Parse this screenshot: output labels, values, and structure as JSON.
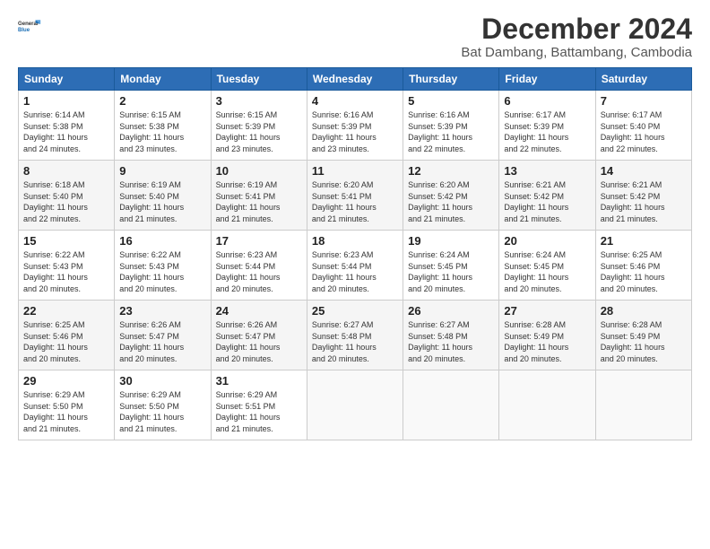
{
  "header": {
    "logo_line1": "General",
    "logo_line2": "Blue",
    "month_title": "December 2024",
    "subtitle": "Bat Dambang, Battambang, Cambodia"
  },
  "calendar": {
    "days_of_week": [
      "Sunday",
      "Monday",
      "Tuesday",
      "Wednesday",
      "Thursday",
      "Friday",
      "Saturday"
    ],
    "weeks": [
      [
        null,
        null,
        null,
        null,
        null,
        null,
        null
      ]
    ],
    "cells": [
      {
        "day": null,
        "sunrise": null,
        "sunset": null,
        "daylight": null
      },
      {
        "day": null,
        "sunrise": null,
        "sunset": null,
        "daylight": null
      },
      {
        "day": null,
        "sunrise": null,
        "sunset": null,
        "daylight": null
      },
      {
        "day": null,
        "sunrise": null,
        "sunset": null,
        "daylight": null
      },
      {
        "day": null,
        "sunrise": null,
        "sunset": null,
        "daylight": null
      },
      {
        "day": null,
        "sunrise": null,
        "sunset": null,
        "daylight": null
      },
      {
        "day": null,
        "sunrise": null,
        "sunset": null,
        "daylight": null
      }
    ]
  },
  "rows": [
    {
      "cells": [
        {
          "day": "1",
          "lines": [
            "Sunrise: 6:14 AM",
            "Sunset: 5:38 PM",
            "Daylight: 11 hours",
            "and 24 minutes."
          ]
        },
        {
          "day": "2",
          "lines": [
            "Sunrise: 6:15 AM",
            "Sunset: 5:38 PM",
            "Daylight: 11 hours",
            "and 23 minutes."
          ]
        },
        {
          "day": "3",
          "lines": [
            "Sunrise: 6:15 AM",
            "Sunset: 5:39 PM",
            "Daylight: 11 hours",
            "and 23 minutes."
          ]
        },
        {
          "day": "4",
          "lines": [
            "Sunrise: 6:16 AM",
            "Sunset: 5:39 PM",
            "Daylight: 11 hours",
            "and 23 minutes."
          ]
        },
        {
          "day": "5",
          "lines": [
            "Sunrise: 6:16 AM",
            "Sunset: 5:39 PM",
            "Daylight: 11 hours",
            "and 22 minutes."
          ]
        },
        {
          "day": "6",
          "lines": [
            "Sunrise: 6:17 AM",
            "Sunset: 5:39 PM",
            "Daylight: 11 hours",
            "and 22 minutes."
          ]
        },
        {
          "day": "7",
          "lines": [
            "Sunrise: 6:17 AM",
            "Sunset: 5:40 PM",
            "Daylight: 11 hours",
            "and 22 minutes."
          ]
        }
      ]
    },
    {
      "cells": [
        {
          "day": "8",
          "lines": [
            "Sunrise: 6:18 AM",
            "Sunset: 5:40 PM",
            "Daylight: 11 hours",
            "and 22 minutes."
          ]
        },
        {
          "day": "9",
          "lines": [
            "Sunrise: 6:19 AM",
            "Sunset: 5:40 PM",
            "Daylight: 11 hours",
            "and 21 minutes."
          ]
        },
        {
          "day": "10",
          "lines": [
            "Sunrise: 6:19 AM",
            "Sunset: 5:41 PM",
            "Daylight: 11 hours",
            "and 21 minutes."
          ]
        },
        {
          "day": "11",
          "lines": [
            "Sunrise: 6:20 AM",
            "Sunset: 5:41 PM",
            "Daylight: 11 hours",
            "and 21 minutes."
          ]
        },
        {
          "day": "12",
          "lines": [
            "Sunrise: 6:20 AM",
            "Sunset: 5:42 PM",
            "Daylight: 11 hours",
            "and 21 minutes."
          ]
        },
        {
          "day": "13",
          "lines": [
            "Sunrise: 6:21 AM",
            "Sunset: 5:42 PM",
            "Daylight: 11 hours",
            "and 21 minutes."
          ]
        },
        {
          "day": "14",
          "lines": [
            "Sunrise: 6:21 AM",
            "Sunset: 5:42 PM",
            "Daylight: 11 hours",
            "and 21 minutes."
          ]
        }
      ]
    },
    {
      "cells": [
        {
          "day": "15",
          "lines": [
            "Sunrise: 6:22 AM",
            "Sunset: 5:43 PM",
            "Daylight: 11 hours",
            "and 20 minutes."
          ]
        },
        {
          "day": "16",
          "lines": [
            "Sunrise: 6:22 AM",
            "Sunset: 5:43 PM",
            "Daylight: 11 hours",
            "and 20 minutes."
          ]
        },
        {
          "day": "17",
          "lines": [
            "Sunrise: 6:23 AM",
            "Sunset: 5:44 PM",
            "Daylight: 11 hours",
            "and 20 minutes."
          ]
        },
        {
          "day": "18",
          "lines": [
            "Sunrise: 6:23 AM",
            "Sunset: 5:44 PM",
            "Daylight: 11 hours",
            "and 20 minutes."
          ]
        },
        {
          "day": "19",
          "lines": [
            "Sunrise: 6:24 AM",
            "Sunset: 5:45 PM",
            "Daylight: 11 hours",
            "and 20 minutes."
          ]
        },
        {
          "day": "20",
          "lines": [
            "Sunrise: 6:24 AM",
            "Sunset: 5:45 PM",
            "Daylight: 11 hours",
            "and 20 minutes."
          ]
        },
        {
          "day": "21",
          "lines": [
            "Sunrise: 6:25 AM",
            "Sunset: 5:46 PM",
            "Daylight: 11 hours",
            "and 20 minutes."
          ]
        }
      ]
    },
    {
      "cells": [
        {
          "day": "22",
          "lines": [
            "Sunrise: 6:25 AM",
            "Sunset: 5:46 PM",
            "Daylight: 11 hours",
            "and 20 minutes."
          ]
        },
        {
          "day": "23",
          "lines": [
            "Sunrise: 6:26 AM",
            "Sunset: 5:47 PM",
            "Daylight: 11 hours",
            "and 20 minutes."
          ]
        },
        {
          "day": "24",
          "lines": [
            "Sunrise: 6:26 AM",
            "Sunset: 5:47 PM",
            "Daylight: 11 hours",
            "and 20 minutes."
          ]
        },
        {
          "day": "25",
          "lines": [
            "Sunrise: 6:27 AM",
            "Sunset: 5:48 PM",
            "Daylight: 11 hours",
            "and 20 minutes."
          ]
        },
        {
          "day": "26",
          "lines": [
            "Sunrise: 6:27 AM",
            "Sunset: 5:48 PM",
            "Daylight: 11 hours",
            "and 20 minutes."
          ]
        },
        {
          "day": "27",
          "lines": [
            "Sunrise: 6:28 AM",
            "Sunset: 5:49 PM",
            "Daylight: 11 hours",
            "and 20 minutes."
          ]
        },
        {
          "day": "28",
          "lines": [
            "Sunrise: 6:28 AM",
            "Sunset: 5:49 PM",
            "Daylight: 11 hours",
            "and 20 minutes."
          ]
        }
      ]
    },
    {
      "cells": [
        {
          "day": "29",
          "lines": [
            "Sunrise: 6:29 AM",
            "Sunset: 5:50 PM",
            "Daylight: 11 hours",
            "and 21 minutes."
          ]
        },
        {
          "day": "30",
          "lines": [
            "Sunrise: 6:29 AM",
            "Sunset: 5:50 PM",
            "Daylight: 11 hours",
            "and 21 minutes."
          ]
        },
        {
          "day": "31",
          "lines": [
            "Sunrise: 6:29 AM",
            "Sunset: 5:51 PM",
            "Daylight: 11 hours",
            "and 21 minutes."
          ]
        },
        {
          "day": null,
          "lines": []
        },
        {
          "day": null,
          "lines": []
        },
        {
          "day": null,
          "lines": []
        },
        {
          "day": null,
          "lines": []
        }
      ]
    }
  ]
}
